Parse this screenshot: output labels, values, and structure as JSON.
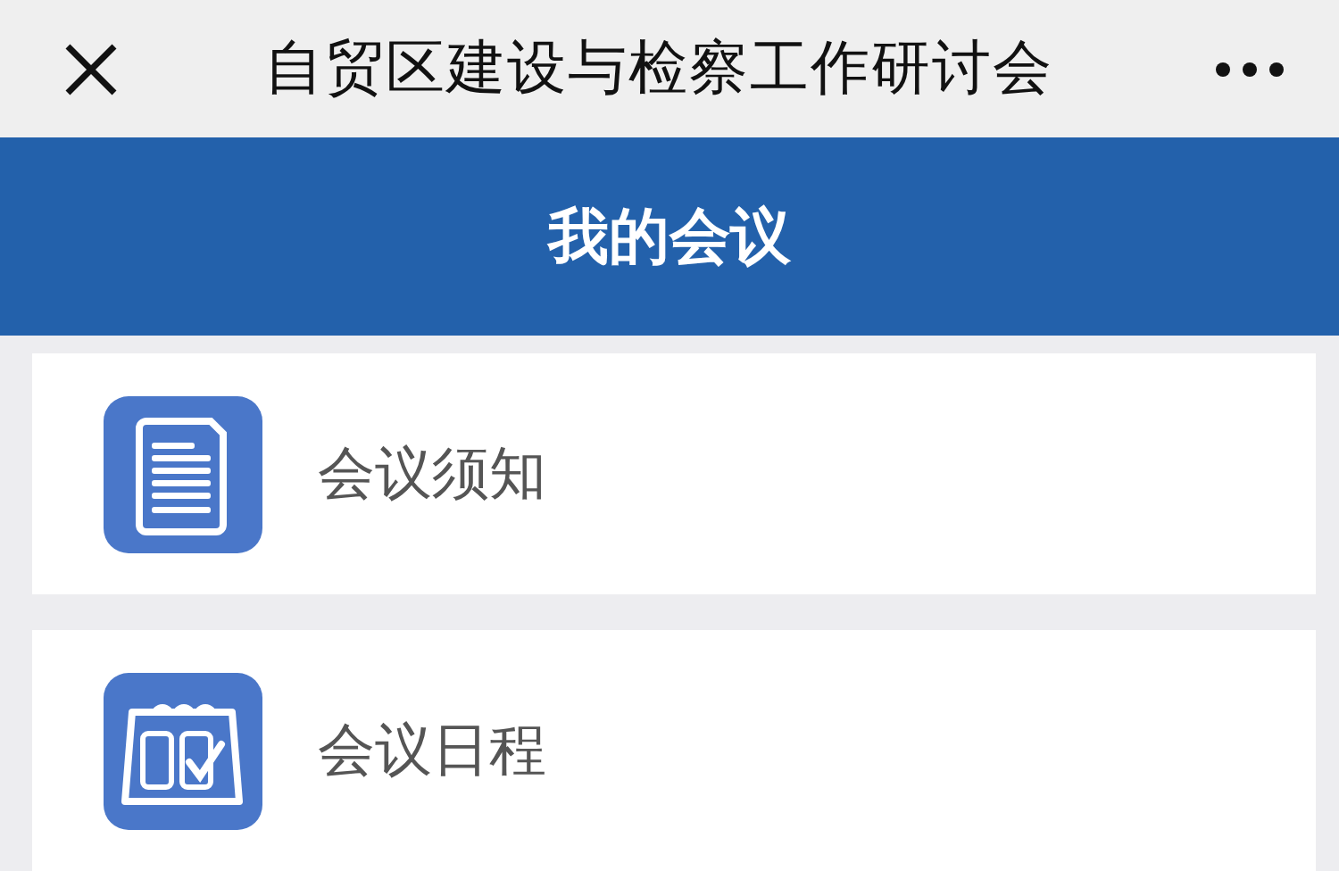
{
  "top_bar": {
    "title": "自贸区建设与检察工作研讨会"
  },
  "header": {
    "title": "我的会议"
  },
  "menu_items": [
    {
      "label": "会议须知",
      "kind": "notice"
    },
    {
      "label": "会议日程",
      "kind": "schedule"
    }
  ]
}
